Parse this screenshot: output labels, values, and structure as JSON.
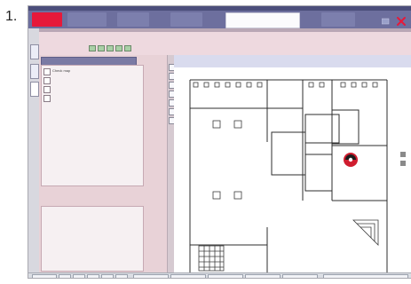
{
  "step": {
    "number": "1."
  },
  "window": {
    "title": ""
  },
  "tabs": [
    {
      "label": ""
    },
    {
      "label": ""
    },
    {
      "label": ""
    },
    {
      "label": ""
    },
    {
      "label": ""
    },
    {
      "label": ""
    }
  ],
  "panel": {
    "info_left_1": "",
    "info_left_2": "",
    "info_mid_1": "",
    "info_mid_2": "",
    "info_right_1": "",
    "info_right_2": "",
    "info_right_3": ""
  },
  "tree": {
    "header": "",
    "items": [
      {
        "label": "Check map"
      },
      {
        "label": ""
      },
      {
        "label": ""
      },
      {
        "label": ""
      }
    ]
  },
  "detail": {
    "label": "",
    "text": ""
  },
  "map": {
    "header_text": ""
  },
  "colors": {
    "accent_red": "#e6193a",
    "tab_bar": "#6d6f9e",
    "info_strip": "#eed9df",
    "tree_panel": "#e8d2d7"
  }
}
